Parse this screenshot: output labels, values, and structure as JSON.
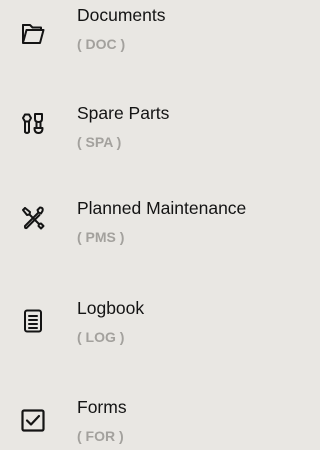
{
  "menu": {
    "items": [
      {
        "label": "Documents",
        "code": "( DOC )",
        "icon": "folder-icon"
      },
      {
        "label": "Spare Parts",
        "code": "( SPA )",
        "icon": "bolt-nut-icon"
      },
      {
        "label": "Planned Maintenance",
        "code": "( PMS )",
        "icon": "wrench-screwdriver-icon"
      },
      {
        "label": "Logbook",
        "code": "( LOG )",
        "icon": "logbook-icon"
      },
      {
        "label": "Forms",
        "code": "( FOR )",
        "icon": "checkbox-icon"
      }
    ]
  },
  "colors": {
    "background": "#e9e7e3",
    "label": "#141414",
    "code": "#a3a19d",
    "icon": "#141414"
  }
}
